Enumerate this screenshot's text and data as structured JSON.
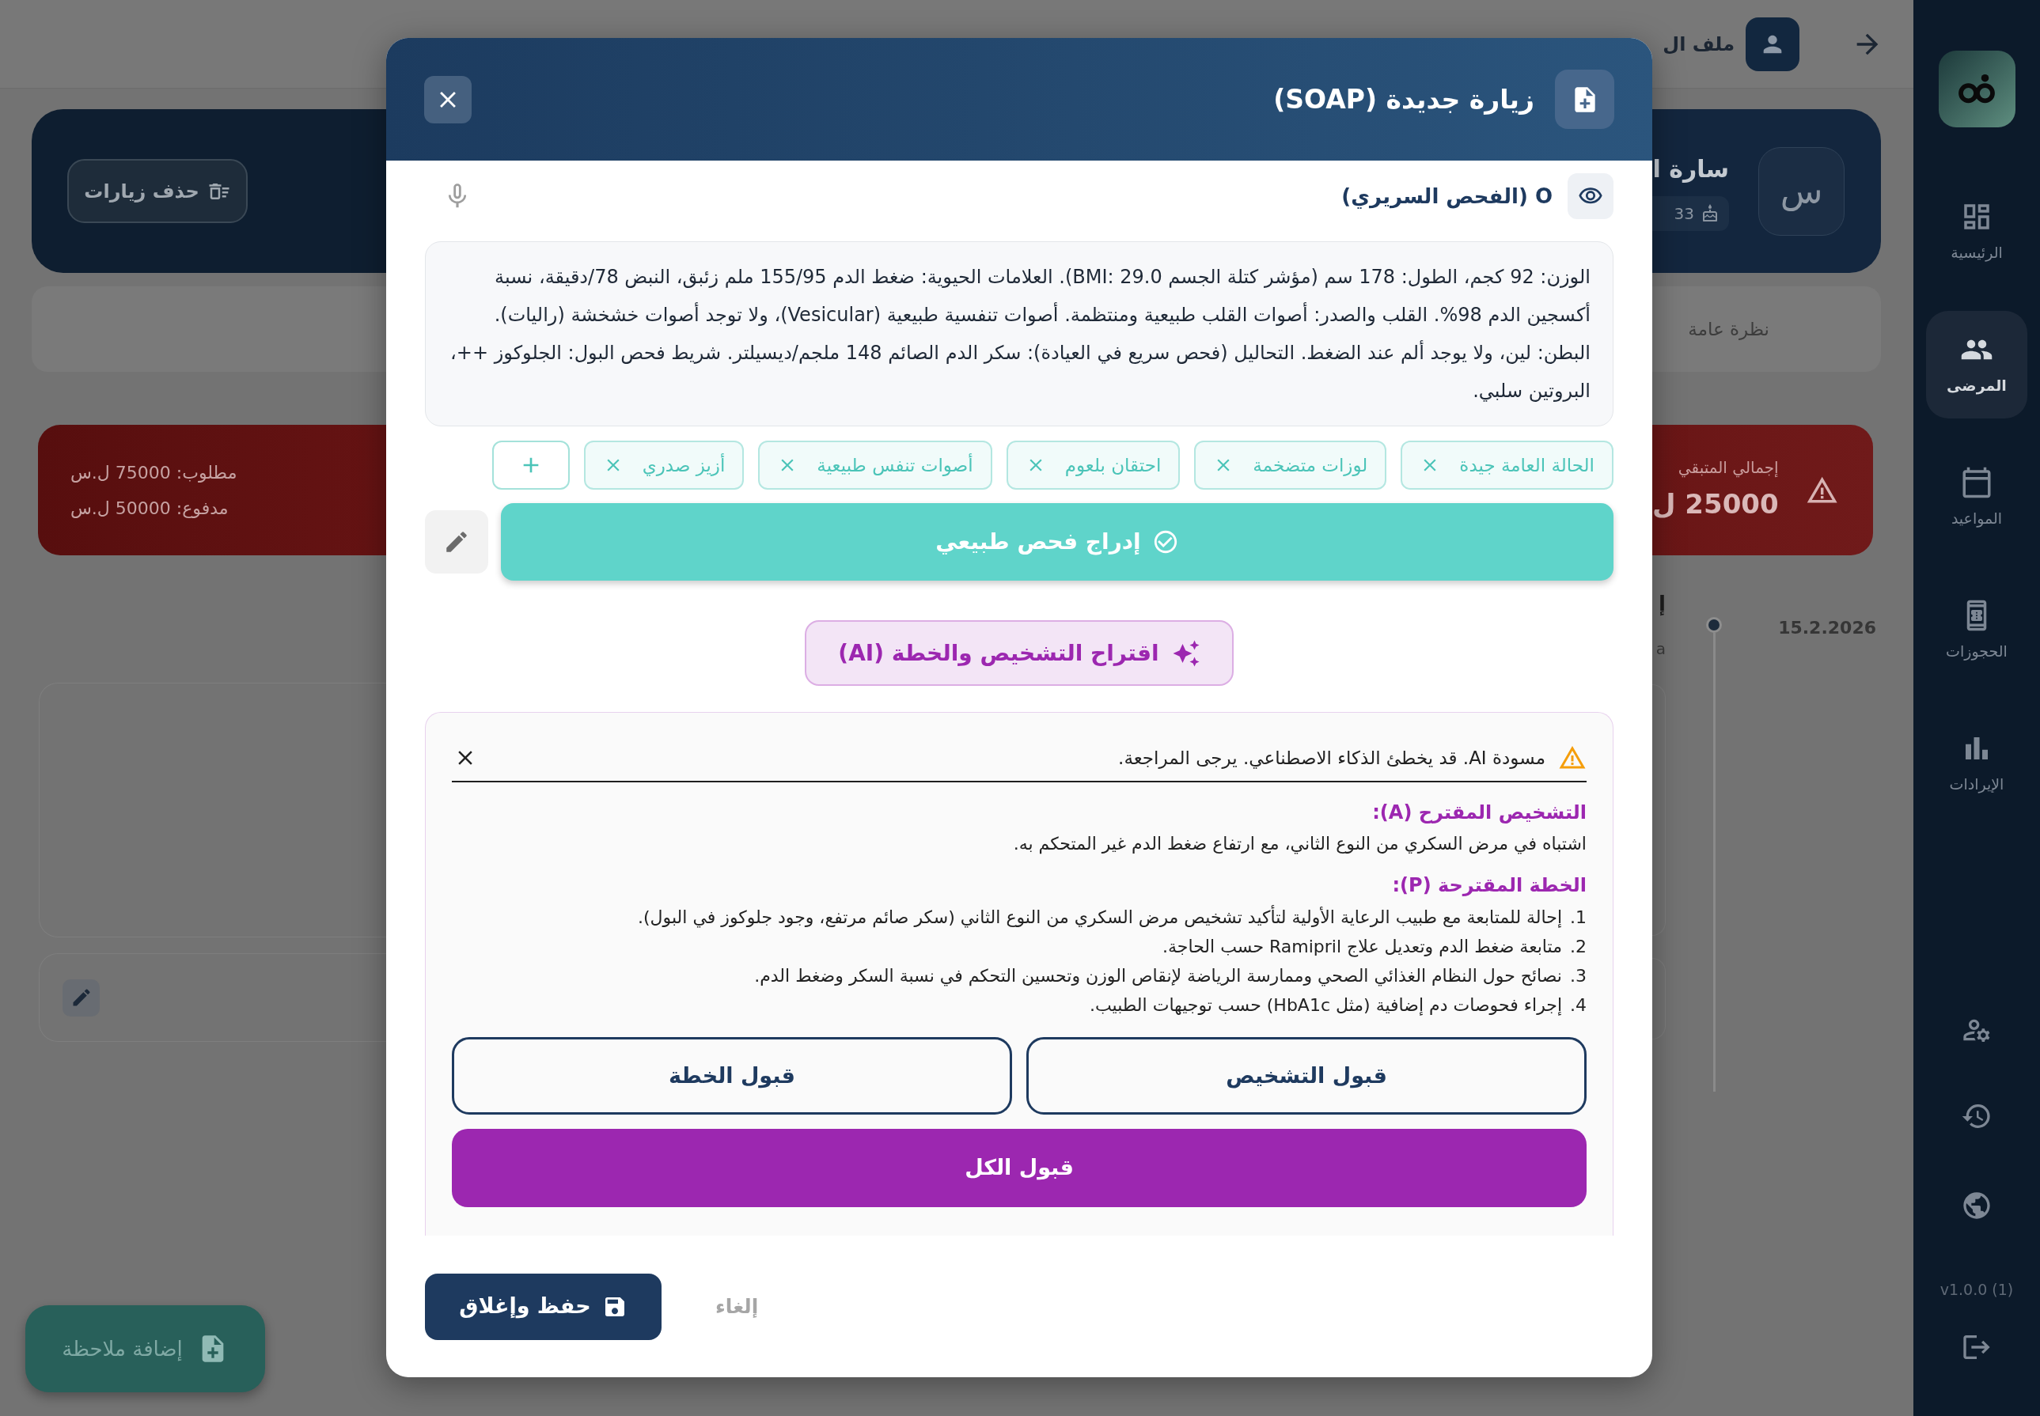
{
  "top_bar": {
    "title": "ملف ال"
  },
  "patient_header": {
    "initial": "س",
    "name": "سارة ا",
    "age": "33",
    "delete_button": "حذف زيارات"
  },
  "tabs": [
    {
      "label": "نظرة عامة"
    }
  ],
  "balance": {
    "required": "مطلوب: 75000 ل.س",
    "paid": "مدفوع: 50000 ل.س",
    "remaining_label": "إجمالي المتبقي",
    "remaining_value": "25000 ل"
  },
  "timeline": [
    {
      "date": "15.2.2026",
      "title": "إ",
      "subtitle": "a"
    }
  ],
  "add_note_button": "إضافة ملاحظة",
  "dialog": {
    "title": "زيارة جديدة (SOAP)",
    "section": {
      "label": "O (الفحص السريري)",
      "text": "الوزن: 92 كجم، الطول: 178 سم (مؤشر كتلة الجسم BMI: 29.0). العلامات الحيوية: ضغط الدم 155/95 ملم زئبق، النبض 78/دقيقة، نسبة أكسجين الدم 98%. القلب والصدر: أصوات القلب طبيعية ومنتظمة. أصوات تنفسية طبيعية (Vesicular)، ولا توجد أصوات خشخشة (راليات). البطن: لين، ولا يوجد ألم عند الضغط. التحاليل (فحص سريع في العيادة): سكر الدم الصائم 148 ملجم/ديسيلتر. شريط فحص البول: الجلوكوز ++، البروتين سلبي."
    },
    "chips": [
      "الحالة العامة جيدة",
      "لوزات متضخمة",
      "احتقان بلعوم",
      "أصوات تنفس طبيعية",
      "أزيز صدري"
    ],
    "insert_button": "إدراج فحص طبيعي",
    "ai_button": "اقتراح التشخيص والخطة (AI)",
    "ai_draft": {
      "warning": "مسودة AI. قد يخطئ الذكاء الاصطناعي. يرجى المراجعة.",
      "assessment_title": "التشخيص المقترح (A):",
      "assessment_text": "اشتباه في مرض السكري من النوع الثاني، مع ارتفاع ضغط الدم غير المتحكم به.",
      "plan_title": "الخطة المقترحة (P):",
      "plan_items": [
        {
          "number": "1.",
          "text": "إحالة للمتابعة مع طبيب الرعاية الأولية لتأكيد تشخيص مرض السكري من النوع الثاني (سكر صائم مرتفع، وجود جلوكوز في البول)."
        },
        {
          "number": "2.",
          "text": "متابعة ضغط الدم وتعديل علاج Ramipril حسب الحاجة."
        },
        {
          "number": "3.",
          "text": "نصائح حول النظام الغذائي الصحي وممارسة الرياضة لإنقاص الوزن وتحسين التحكم في نسبة السكر وضغط الدم."
        },
        {
          "number": "4.",
          "text": "إجراء فحوصات دم إضافية (مثل HbA1c) حسب توجيهات الطبيب."
        }
      ],
      "accept_diagnosis": "قبول التشخيص",
      "accept_plan": "قبول الخطة",
      "accept_all": "قبول الكل"
    },
    "footer": {
      "save": "حفظ وإغلاق",
      "cancel": "إلغاء"
    }
  },
  "sidebar": {
    "items": [
      {
        "label": "الرئيسية",
        "selected": false
      },
      {
        "label": "المرضى",
        "selected": true
      },
      {
        "label": "المواعيد",
        "selected": false
      },
      {
        "label": "الحجوزات",
        "selected": false
      },
      {
        "label": "الإيرادات",
        "selected": false
      }
    ],
    "version": "v1.0.0 (1)"
  }
}
